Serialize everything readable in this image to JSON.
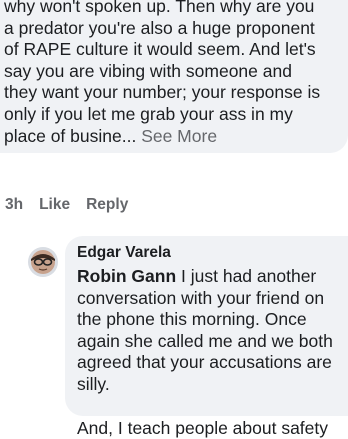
{
  "top_comment": {
    "body_text": "why won't spoken up. Then why are you a predator you're also a huge proponent of RAPE culture it would seem. And let's say you are vibing with someone and they want your number; your response is only if you let me grab your ass in my place of busine...",
    "see_more": "See More"
  },
  "actions": {
    "time": "3h",
    "like": "Like",
    "reply": "Reply"
  },
  "reply": {
    "author": "Edgar Varela",
    "mention": "Robin Gann",
    "text": " I just had another conversation with your friend on the phone this morning. Once again she called me and we both agreed that your accusations are silly.",
    "text_2": "And, I teach people about safety"
  }
}
